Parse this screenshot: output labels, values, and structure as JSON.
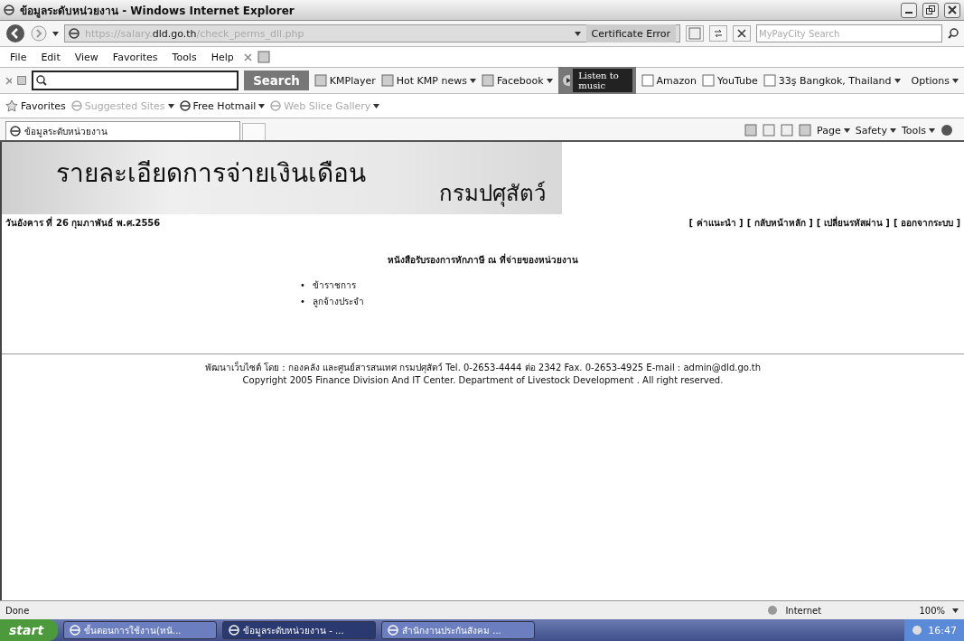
{
  "window": {
    "title": "ข้อมูลระดับหน่วยงาน - Windows Internet Explorer"
  },
  "address_bar": {
    "url_faded_start": "https://salary.",
    "url_host": "dld.go.th",
    "url_faded_end": "/check_perms_dll.php",
    "certificate": "Certificate Error",
    "search_placeholder": "MyPayCity Search"
  },
  "menu": [
    "File",
    "Edit",
    "View",
    "Favorites",
    "Tools",
    "Help"
  ],
  "toolbar": {
    "search_button": "Search",
    "links": [
      {
        "label": "KMPlayer",
        "dropdown": false
      },
      {
        "label": "Hot KMP news",
        "dropdown": true
      },
      {
        "label": "Facebook",
        "dropdown": true
      }
    ],
    "music": "Listen to music",
    "links2": [
      {
        "label": "Amazon",
        "dropdown": false
      },
      {
        "label": "YouTube",
        "dropdown": false
      },
      {
        "label": "33ş Bangkok, Thailand",
        "dropdown": true
      }
    ],
    "options": "Options"
  },
  "favorites_bar": {
    "label": "Favorites",
    "items": [
      {
        "label": "Suggested Sites",
        "disabled": true
      },
      {
        "label": "Free Hotmail",
        "disabled": false
      },
      {
        "label": "Web Slice Gallery",
        "disabled": true
      }
    ]
  },
  "tab": {
    "title": "ข้อมูลระดับหน่วยงาน"
  },
  "command_bar": [
    "Page",
    "Safety",
    "Tools"
  ],
  "page": {
    "banner_title": "รายละเอียดการจ่ายเงินเดือน",
    "banner_org": "กรมปศุสัตว์",
    "date": "วันอังคาร ที่ 26 กุมภาพันธ์ พ.ศ.2556",
    "nav_links": [
      "[ ค่าแนะนำ ]",
      "[ กลับหน้าหลัก ]",
      "[ เปลี่ยนรหัสผ่าน ]",
      "[ ออกจากระบบ ]"
    ],
    "heading": "หนังสือรับรองการหักภาษี ณ ที่จ่ายของหน่วยงาน",
    "list_marker": "•",
    "list": [
      "ข้าราชการ",
      "ลูกจ้างประจำ"
    ],
    "footer": [
      "พัฒนาเว็บไซต์ โดย : กองคลัง และศูนย์สารสนเทศ กรมปศุสัตว์ Tel. 0-2653-4444 ต่อ 2342 Fax. 0-2653-4925 E-mail : admin@dld.go.th",
      "Copyright 2005 Finance Division And IT Center. Department of Livestock Development . All right reserved."
    ]
  },
  "status_bar": {
    "text": "Done",
    "zone": "Internet",
    "zoom": "100%"
  },
  "taskbar": {
    "start": "start",
    "items": [
      {
        "label": "ขั้นตอนการใช้งาน(หนั...",
        "selected": false
      },
      {
        "label": "ข้อมูลระดับหน่วยงาน - ...",
        "selected": true
      },
      {
        "label": "สำนักงานประกันสังคม ...",
        "selected": false
      }
    ],
    "clock": "16:47"
  }
}
